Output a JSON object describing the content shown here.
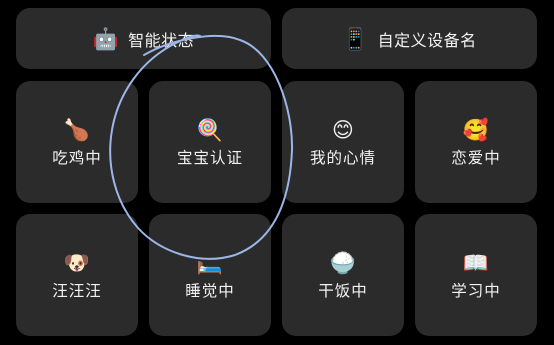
{
  "top_tiles": [
    {
      "label": "智能状态",
      "icon": "robot-icon",
      "glyph": "🤖"
    },
    {
      "label": "自定义设备名",
      "icon": "phone-icon",
      "glyph": "📱"
    }
  ],
  "grid_row_1": [
    {
      "label": "吃鸡中",
      "icon": "roast-chicken-icon",
      "glyph": "🍗"
    },
    {
      "label": "宝宝认证",
      "icon": "lollipop-icon",
      "glyph": "🍭"
    },
    {
      "label": "我的心情",
      "icon": "smiling-face-icon",
      "glyph": "😊"
    },
    {
      "label": "恋爱中",
      "icon": "smiling-face-with-hearts-icon",
      "glyph": "🥰"
    }
  ],
  "grid_row_2": [
    {
      "label": "汪汪汪",
      "icon": "dog-face-icon",
      "glyph": "🐶"
    },
    {
      "label": "睡觉中",
      "icon": "bed-icon",
      "glyph": "🛏️"
    },
    {
      "label": "干饭中",
      "icon": "rice-bowl-icon",
      "glyph": "🍚"
    },
    {
      "label": "学习中",
      "icon": "open-book-icon",
      "glyph": "📖"
    }
  ],
  "colors": {
    "background": "#000000",
    "tile": "#2b2b2b",
    "text": "#f2f2f2",
    "annotation_stroke": "#9cb6e8"
  }
}
